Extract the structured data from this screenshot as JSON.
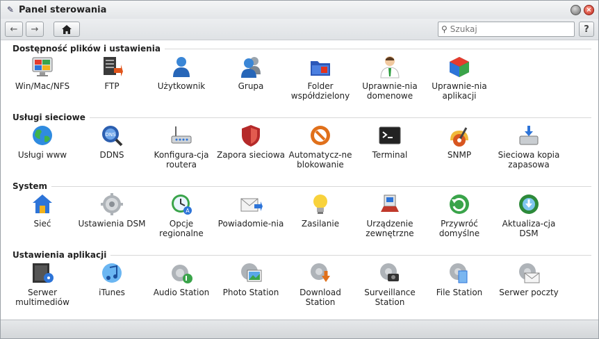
{
  "window": {
    "title": "Panel sterowania",
    "icon": "wrench-icon"
  },
  "toolbar": {
    "search_placeholder": "Szukaj",
    "help_label": "?"
  },
  "sections": [
    {
      "title": "Dostępność plików i ustawienia",
      "items": [
        {
          "label": "Win/Mac/NFS",
          "icon": "monitor-icon"
        },
        {
          "label": "FTP",
          "icon": "ftp-icon"
        },
        {
          "label": "Użytkownik",
          "icon": "user-icon"
        },
        {
          "label": "Grupa",
          "icon": "group-icon"
        },
        {
          "label": "Folder współdzielony",
          "icon": "folder-icon"
        },
        {
          "label": "Uprawnie-nia domenowe",
          "icon": "domain-user-icon"
        },
        {
          "label": "Uprawnie-nia aplikacji",
          "icon": "cube-icon"
        }
      ]
    },
    {
      "title": "Usługi sieciowe",
      "items": [
        {
          "label": "Usługi www",
          "icon": "globe-icon"
        },
        {
          "label": "DDNS",
          "icon": "ddns-icon"
        },
        {
          "label": "Konfigura-cja routera",
          "icon": "router-icon"
        },
        {
          "label": "Zapora sieciowa",
          "icon": "shield-icon"
        },
        {
          "label": "Automatycz-ne blokowanie",
          "icon": "block-icon"
        },
        {
          "label": "Terminal",
          "icon": "terminal-icon"
        },
        {
          "label": "SNMP",
          "icon": "snmp-icon"
        },
        {
          "label": "Sieciowa kopia zapasowa",
          "icon": "backup-icon"
        }
      ]
    },
    {
      "title": "System",
      "items": [
        {
          "label": "Sieć",
          "icon": "network-icon"
        },
        {
          "label": "Ustawienia DSM",
          "icon": "gear-icon"
        },
        {
          "label": "Opcje regionalne",
          "icon": "clock-icon"
        },
        {
          "label": "Powiadomie-nia",
          "icon": "mail-icon"
        },
        {
          "label": "Zasilanie",
          "icon": "bulb-icon"
        },
        {
          "label": "Urządzenie zewnętrzne",
          "icon": "device-icon"
        },
        {
          "label": "Przywróć domyślne",
          "icon": "restore-icon"
        },
        {
          "label": "Aktualiza-cja DSM",
          "icon": "update-icon"
        }
      ]
    },
    {
      "title": "Ustawienia aplikacji",
      "items": [
        {
          "label": "Serwer multimediów",
          "icon": "media-icon"
        },
        {
          "label": "iTunes",
          "icon": "music-icon"
        },
        {
          "label": "Audio Station",
          "icon": "audio-gear-icon"
        },
        {
          "label": "Photo Station",
          "icon": "photo-icon"
        },
        {
          "label": "Download Station",
          "icon": "download-icon"
        },
        {
          "label": "Surveillance Station",
          "icon": "camera-icon"
        },
        {
          "label": "File Station",
          "icon": "file-gear-icon"
        },
        {
          "label": "Serwer poczty",
          "icon": "mail-gear-icon"
        }
      ]
    }
  ]
}
